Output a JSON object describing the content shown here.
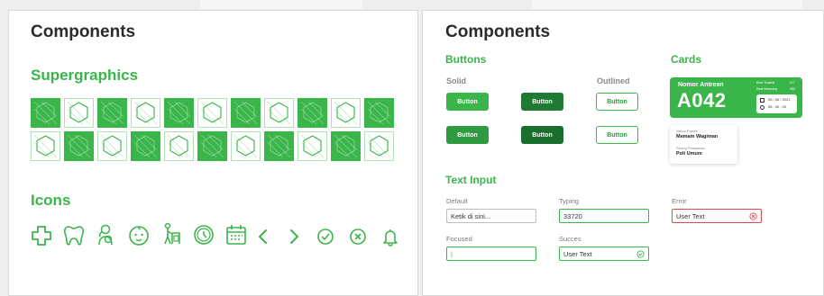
{
  "colors": {
    "brand_green": "#3ab54a",
    "brand_green_dark": "#2f9a3f",
    "brand_green_darker": "#1f7a34",
    "error_red": "#e04848",
    "heading_text": "#2b2b2b"
  },
  "left_panel": {
    "title": "Components",
    "supergraphics": {
      "title": "Supergraphics",
      "row1": [
        "solid",
        "outline",
        "solid",
        "outline",
        "solid",
        "outline",
        "solid",
        "outline",
        "solid",
        "outline",
        "solid"
      ],
      "row2": [
        "outline",
        "solid",
        "outline",
        "solid",
        "outline",
        "solid",
        "outline",
        "solid",
        "outline",
        "solid",
        "outline"
      ]
    },
    "icons": {
      "title": "Icons",
      "items": [
        "medical-cross-icon",
        "tooth-icon",
        "mother-baby-icon",
        "baby-face-icon",
        "elderly-walker-icon",
        "clock-icon",
        "calendar-icon",
        "chevron-left-icon",
        "chevron-right-icon",
        "check-circle-icon",
        "close-circle-icon",
        "bell-icon"
      ]
    }
  },
  "right_panel": {
    "title": "Components",
    "buttons": {
      "title": "Buttons",
      "solid_label": "Solid",
      "outlined_label": "Outlined",
      "label": "Button"
    },
    "cards": {
      "title": "Cards",
      "queue_label": "Nomor Antrean",
      "queue_number": "A042",
      "info_left_1": "Real Terakhir",
      "info_right_1": "077",
      "info_left_2": "Real Sekarang",
      "info_right_2": "083",
      "date": "06 / 06 / 2021",
      "time": "08 : 00 : 00",
      "patient_label": "Nama Pasien",
      "patient_name": "Mamam Wagiman",
      "room_label": "Ruang Pelayanan",
      "room_name": "Poli Umum"
    },
    "text_input": {
      "title": "Text Input",
      "default_label": "Default",
      "default_value": "Ketik di sini...",
      "typing_label": "Typing",
      "typing_value": "33720",
      "error_label": "Error",
      "error_value": "User Text",
      "focused_label": "Focused",
      "focused_value": "|",
      "success_label": "Succes",
      "success_value": "User Text"
    }
  }
}
